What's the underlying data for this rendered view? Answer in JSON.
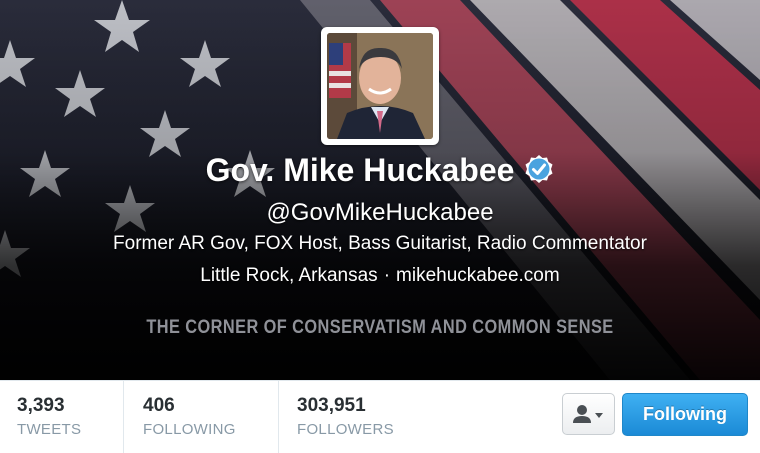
{
  "profile": {
    "name": "Gov. Mike Huckabee",
    "handle": "@GovMikeHuckabee",
    "bio": "Former AR Gov, FOX Host, Bass Guitarist, Radio Commentator",
    "location": "Little Rock, Arkansas",
    "separator": "·",
    "website": "mikehuckabee.com",
    "verified": true
  },
  "header": {
    "tagline": "THE CORNER OF CONSERVATISM AND COMMON SENSE"
  },
  "stats": [
    {
      "value": "3,393",
      "label": "TWEETS"
    },
    {
      "value": "406",
      "label": "FOLLOWING"
    },
    {
      "value": "303,951",
      "label": "FOLLOWERS"
    }
  ],
  "actions": {
    "user_menu_icon": "person-dropdown-icon",
    "follow_label": "Following"
  },
  "colors": {
    "accent": "#1b8ad6",
    "verified": "#4aa3df",
    "stat_label": "#8899a6"
  }
}
